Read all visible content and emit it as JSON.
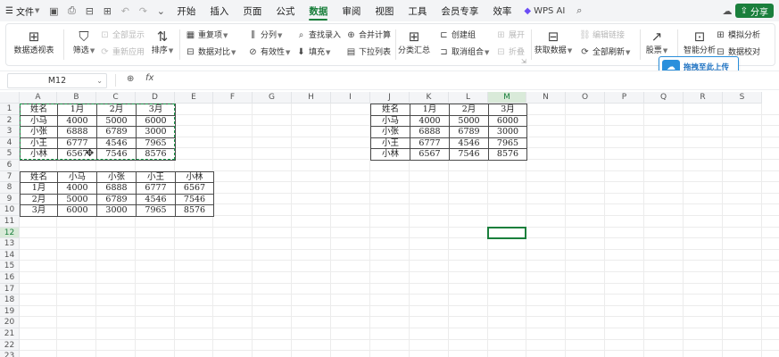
{
  "menubar": {
    "file_label": "文件",
    "tabs": [
      {
        "label": "开始",
        "active": false
      },
      {
        "label": "插入",
        "active": false
      },
      {
        "label": "页面",
        "active": false
      },
      {
        "label": "公式",
        "active": false
      },
      {
        "label": "数据",
        "active": true
      },
      {
        "label": "审阅",
        "active": false
      },
      {
        "label": "视图",
        "active": false
      },
      {
        "label": "工具",
        "active": false
      },
      {
        "label": "会员专享",
        "active": false
      },
      {
        "label": "效率",
        "active": false
      }
    ],
    "wps_ai_label": "WPS AI",
    "share_label": "分享"
  },
  "ribbon": {
    "pivot": "数据透视表",
    "filter": "筛选",
    "show_all": "全部显示",
    "reapply": "重新应用",
    "sort": "排序",
    "duplicates": "重复项",
    "compare": "数据对比",
    "split": "分列",
    "validity": "有效性",
    "lookup": "查找录入",
    "fill": "填充",
    "consolidate": "合并计算",
    "dropdown": "下拉列表",
    "subtotal": "分类汇总",
    "create_group": "创建组",
    "ungroup": "取消组合",
    "expand": "展开",
    "collapse": "折叠",
    "get_data": "获取数据",
    "edit_links": "编辑链接",
    "refresh_all": "全部刷新",
    "stocks": "股票",
    "smart_analysis": "智能分析",
    "simulation": "模拟分析",
    "data_check": "数据校对",
    "upload_tip": "拖拽至此上传"
  },
  "formula_bar": {
    "name_box": "M12",
    "fx": "fx",
    "value": ""
  },
  "columns": [
    "A",
    "B",
    "C",
    "D",
    "E",
    "F",
    "G",
    "H",
    "I",
    "J",
    "K",
    "L",
    "M",
    "N",
    "O",
    "P",
    "Q",
    "R",
    "S"
  ],
  "rows": [
    "1",
    "2",
    "3",
    "4",
    "5",
    "6",
    "7",
    "8",
    "9",
    "10",
    "11",
    "12",
    "13",
    "14",
    "15",
    "16",
    "17",
    "18",
    "19",
    "20",
    "21",
    "22",
    "23"
  ],
  "selected_column": "M",
  "selected_row": "12",
  "table1": [
    [
      "姓名",
      "1月",
      "2月",
      "3月"
    ],
    [
      "小马",
      "4000",
      "5000",
      "6000"
    ],
    [
      "小张",
      "6888",
      "6789",
      "3000"
    ],
    [
      "小王",
      "6777",
      "4546",
      "7965"
    ],
    [
      "小林",
      "6567",
      "7546",
      "8576"
    ]
  ],
  "table2": [
    [
      "姓名",
      "小马",
      "小张",
      "小王",
      "小林"
    ],
    [
      "1月",
      "4000",
      "6888",
      "6777",
      "6567"
    ],
    [
      "2月",
      "5000",
      "6789",
      "4546",
      "7546"
    ],
    [
      "3月",
      "6000",
      "3000",
      "7965",
      "8576"
    ]
  ],
  "table3": [
    [
      "姓名",
      "1月",
      "2月",
      "3月"
    ],
    [
      "小马",
      "4000",
      "5000",
      "6000"
    ],
    [
      "小张",
      "6888",
      "6789",
      "3000"
    ],
    [
      "小王",
      "6777",
      "4546",
      "7965"
    ],
    [
      "小林",
      "6567",
      "7546",
      "8576"
    ]
  ],
  "colors": {
    "accent": "#1a7f3c",
    "copy_border": "#1a9a4a",
    "upload_blue": "#2a8fdc"
  }
}
